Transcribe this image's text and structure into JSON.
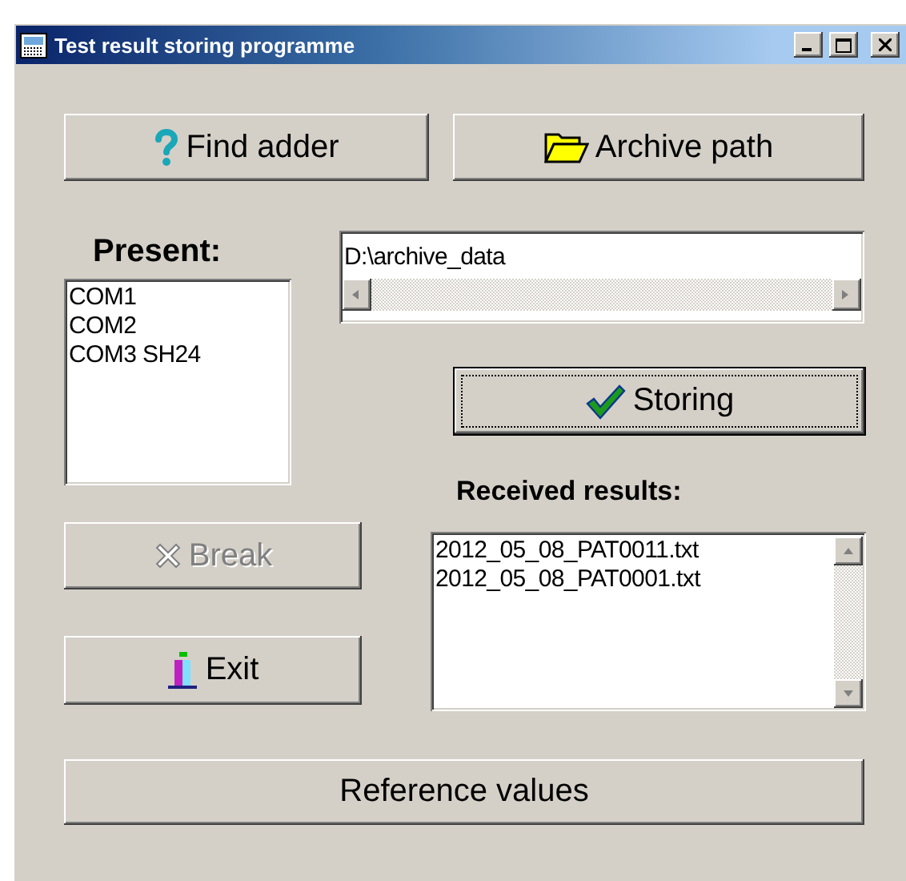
{
  "window": {
    "title": "Test result storing programme"
  },
  "top_buttons": [
    {
      "label": "Find adder"
    },
    {
      "label": "Archive path"
    }
  ],
  "present": {
    "label": "Present:",
    "items": [
      "COM1",
      "COM2",
      "COM3 SH24"
    ]
  },
  "archive_path": {
    "value": "D:\\archive_data"
  },
  "storing_button": {
    "label": "Storing",
    "default": true
  },
  "received": {
    "label": "Received results:",
    "items": [
      "2012_05_08_PAT0011.txt",
      "2012_05_08_PAT0001.txt"
    ]
  },
  "break_button": {
    "label": "Break",
    "disabled": true
  },
  "exit_button": {
    "label": "Exit",
    "disabled": false
  },
  "reference_button": {
    "label": "Reference values"
  }
}
